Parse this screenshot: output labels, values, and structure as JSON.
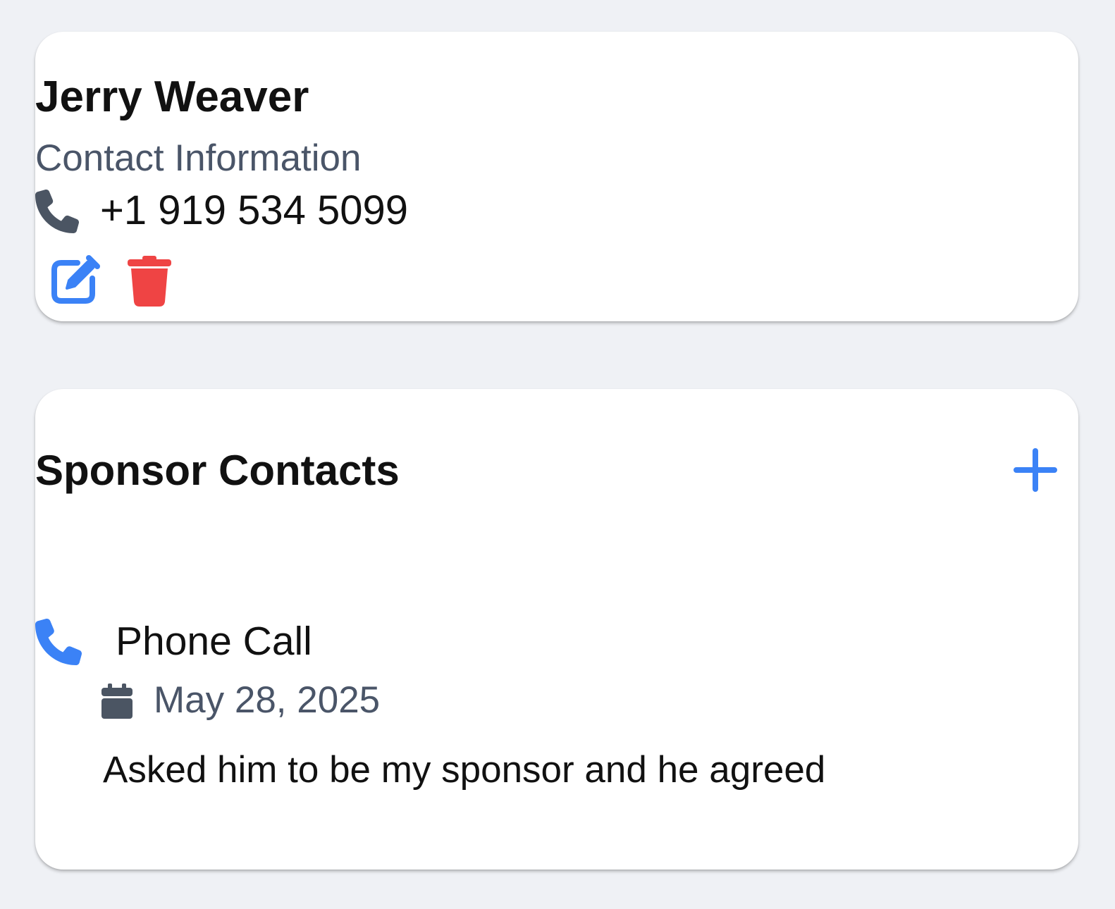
{
  "contact": {
    "name": "Jerry Weaver",
    "subtitle": "Contact Information",
    "phone": "+1 919 534 5099",
    "icons": {
      "phone": "phone-icon",
      "edit": "edit-icon",
      "delete": "trash-icon"
    }
  },
  "sponsor_contacts": {
    "title": "Sponsor Contacts",
    "add_icon": "plus-icon",
    "entries": [
      {
        "type": "Phone Call",
        "date": "May 28, 2025",
        "note": "Asked him to be my sponsor and he agreed",
        "icon": "phone-icon",
        "date_icon": "calendar-icon"
      }
    ]
  },
  "colors": {
    "background": "#eff1f5",
    "card": "#ffffff",
    "accent_blue": "#3b82f6",
    "danger_red": "#ef4444",
    "muted_text": "#4a5568",
    "icon_gray": "#4b5563"
  }
}
